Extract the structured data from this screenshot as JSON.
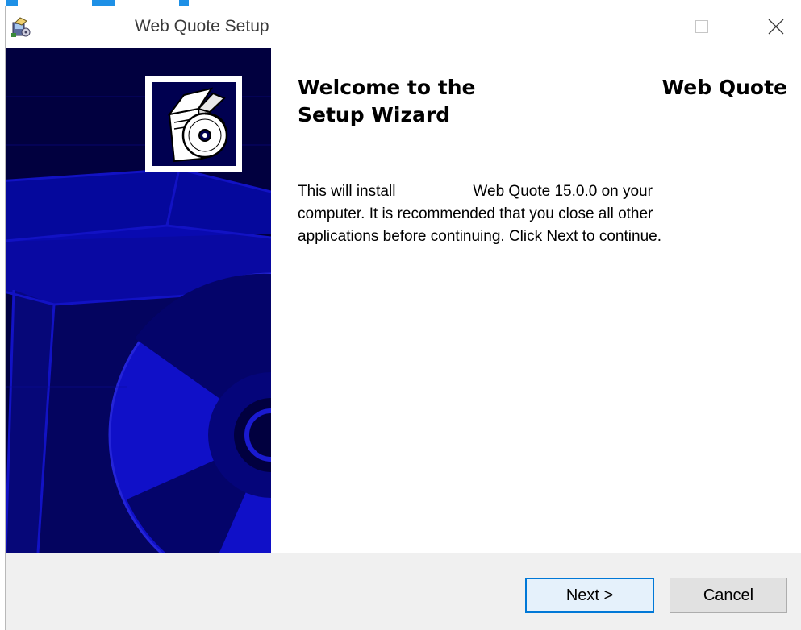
{
  "window": {
    "title": "Web Quote Setup",
    "controls": {
      "minimize_glyph": "—",
      "maximize_glyph": "☐",
      "close_glyph": "✕"
    }
  },
  "welcome": {
    "heading_part1": "Welcome to the",
    "heading_part2": "Web Quote",
    "heading_line2": "Setup Wizard"
  },
  "description": {
    "line1_a": "This will install",
    "line1_b": "Web Quote 15.0.0 on your",
    "line2": "computer. It is recommended that you close all other",
    "line3": "applications before continuing. Click Next to continue."
  },
  "buttons": {
    "next": "Next >",
    "cancel": "Cancel"
  },
  "colors": {
    "side_panel_bg": "#01003f",
    "side_panel_art": "#0a0aa8",
    "primary_button_border": "#0078d7",
    "footer_bg": "#f0f0f0"
  },
  "icons": {
    "app": "installer-package-icon",
    "logo": "box-with-disc-icon",
    "minimize": "minimize-icon",
    "maximize": "maximize-icon",
    "close": "close-icon"
  }
}
